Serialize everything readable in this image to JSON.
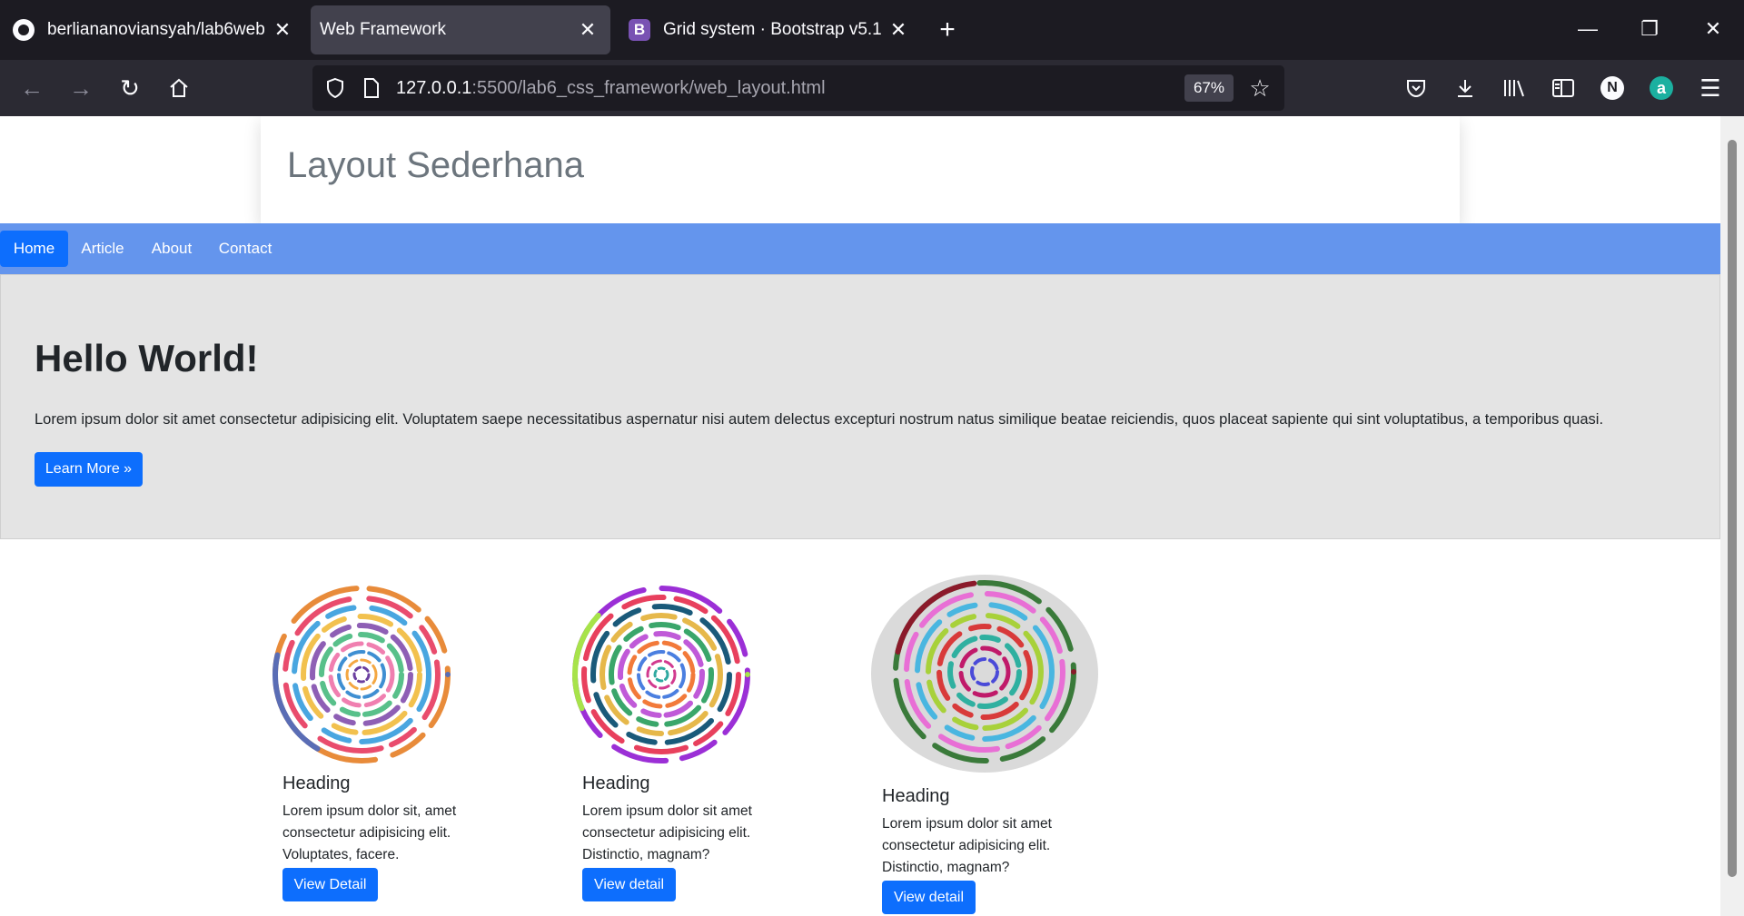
{
  "browser": {
    "tabs": [
      {
        "title": "berliananoviansyah/lab6web",
        "active": false,
        "favicon": "github-icon"
      },
      {
        "title": "Web Framework",
        "active": true,
        "favicon": "none"
      },
      {
        "title": "Grid system · Bootstrap v5.1",
        "active": false,
        "favicon": "bootstrap-icon",
        "favicon_letter": "B"
      }
    ],
    "url_host": "127.0.0.1",
    "url_rest": ":5500/lab6_css_framework/web_layout.html",
    "zoom": "67%",
    "profile_letter": "N",
    "addon_letter": "a"
  },
  "site": {
    "title": "Layout Sederhana",
    "nav": [
      {
        "label": "Home",
        "active": true
      },
      {
        "label": "Article",
        "active": false
      },
      {
        "label": "About",
        "active": false
      },
      {
        "label": "Contact",
        "active": false
      }
    ],
    "hero": {
      "heading": "Hello World!",
      "text": "Lorem ipsum dolor sit amet consectetur adipisicing elit. Voluptatem saepe necessitatibus aspernatur nisi autem delectus excepturi nostrum natus similique beatae reiciendis, quos placeat sapiente qui sint voluptatibus, a temporibus quasi.",
      "button": "Learn More »"
    },
    "cards": [
      {
        "heading": "Heading",
        "text": "Lorem ipsum dolor sit, amet consectetur adipisicing elit. Voluptates, facere.",
        "button": "View Detail"
      },
      {
        "heading": "Heading",
        "text": "Lorem ipsum dolor sit amet consectetur adipisicing elit. Distinctio, magnam?",
        "button": "View detail"
      },
      {
        "heading": "Heading",
        "text": "Lorem ipsum dolor sit amet consectetur adipisicing elit. Distinctio, magnam?",
        "button": "View detail"
      }
    ]
  },
  "colors": {
    "nav_bg": "#6495ed",
    "primary": "#0d6efd",
    "hero_bg": "#e4e4e4"
  }
}
